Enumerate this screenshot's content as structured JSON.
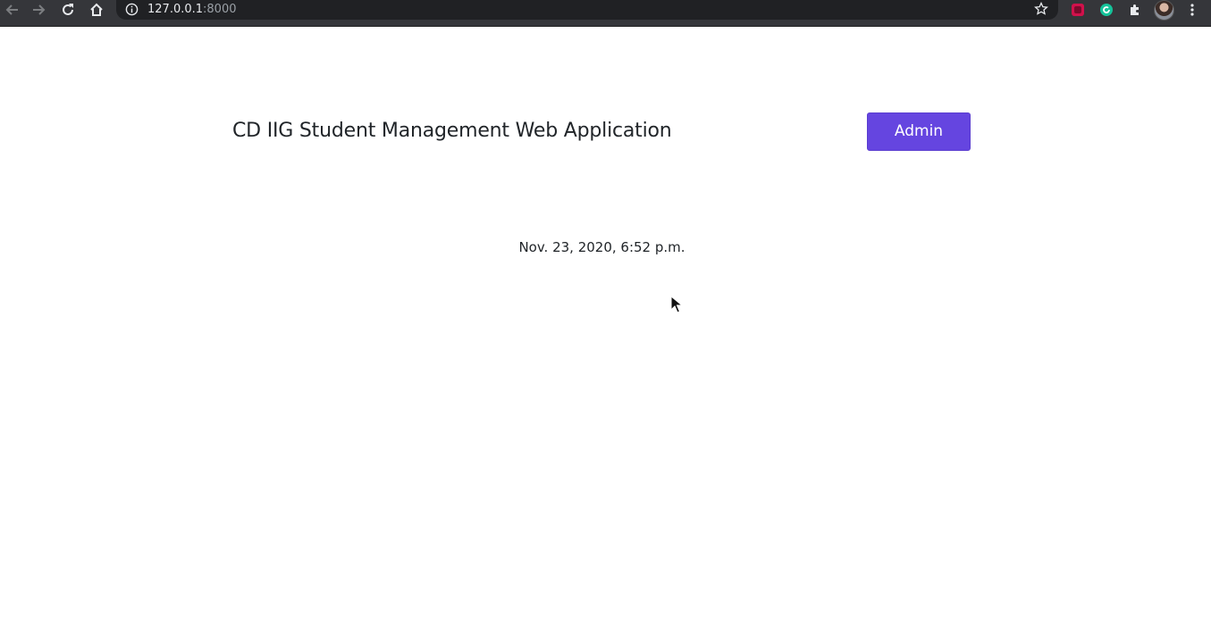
{
  "browser": {
    "url_host": "127.0.0.1",
    "url_port": ":8000",
    "icons": {
      "back": "back-arrow-icon",
      "forward": "forward-arrow-icon",
      "reload": "reload-icon",
      "home": "home-icon",
      "site_info": "info-icon",
      "bookmark": "star-icon",
      "extensions": "puzzle-icon",
      "menu": "kebab-menu-icon"
    }
  },
  "page": {
    "title": "CD IIG Student Management Web Application",
    "admin_button_label": "Admin",
    "timestamp": "Nov. 23, 2020, 6:52 p.m."
  },
  "colors": {
    "accent": "#6545e0",
    "text": "#212529",
    "browser_bar": "#35363a",
    "omnibox": "#202124"
  }
}
